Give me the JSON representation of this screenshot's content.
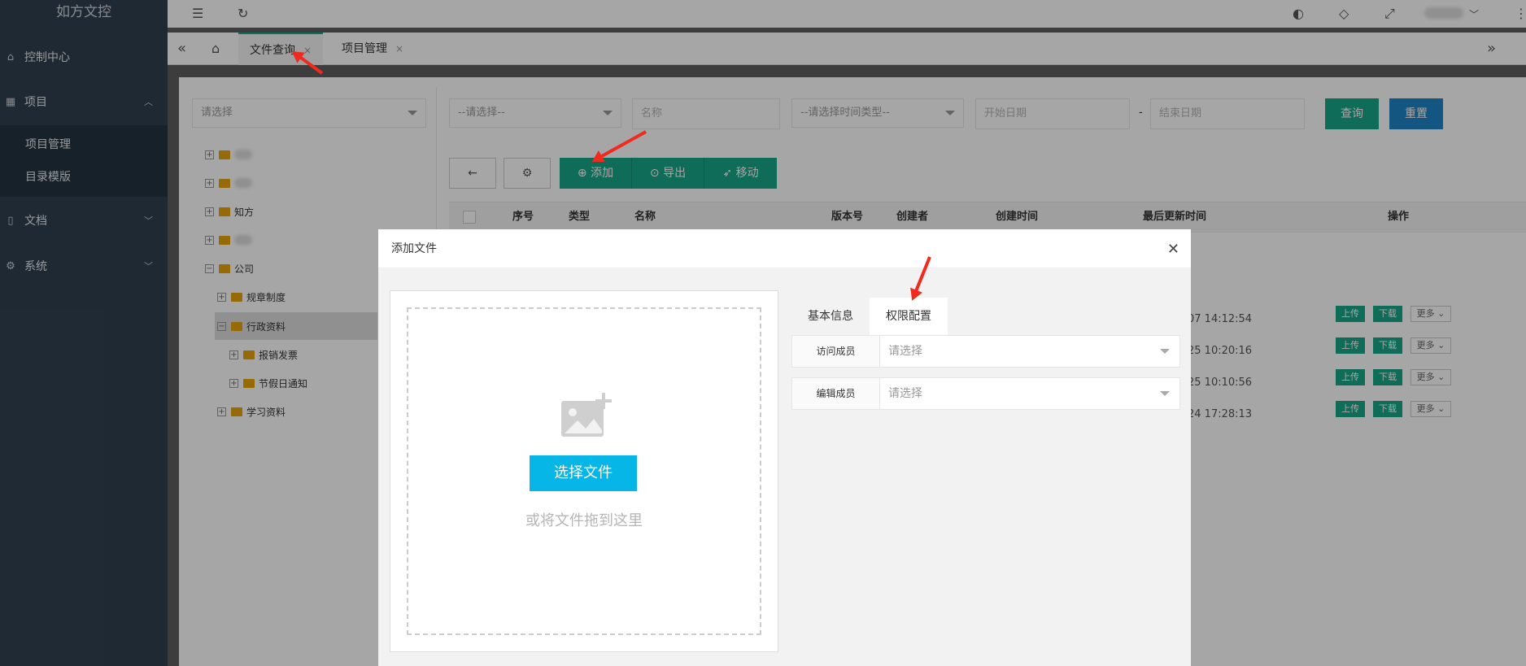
{
  "sidebar": {
    "brand": "如方文控",
    "items": [
      {
        "label": "控制中心",
        "icon": "home-icon"
      },
      {
        "label": "项目",
        "icon": "grid-icon"
      },
      {
        "label": "文档",
        "icon": "document-icon"
      },
      {
        "label": "系统",
        "icon": "gear-icon"
      }
    ],
    "sub_items": [
      "项目管理",
      "目录模版"
    ]
  },
  "tabs": [
    {
      "label": "文件查询"
    },
    {
      "label": "项目管理"
    }
  ],
  "tree": {
    "select_placeholder": "请选择",
    "nodes": [
      {
        "label": "知方"
      },
      {
        "label": "公司"
      },
      {
        "label": "规章制度"
      },
      {
        "label": "行政资料"
      },
      {
        "label": "报销发票"
      },
      {
        "label": "节假日通知"
      },
      {
        "label": "学习资料"
      }
    ]
  },
  "filters": {
    "category_placeholder": "--请选择--",
    "name_placeholder": "名称",
    "time_type_placeholder": "--请选择时间类型--",
    "start_date": "开始日期",
    "date_sep": "-",
    "end_date": "结束日期",
    "query_label": "查询",
    "reset_label": "重置"
  },
  "toolbar": {
    "add_label": "添加",
    "export_label": "导出",
    "move_label": "移动"
  },
  "table": {
    "headers": [
      "序号",
      "类型",
      "名称",
      "版本号",
      "创建者",
      "创建时间",
      "最后更新时间",
      "操作"
    ],
    "rows": [
      {
        "time": "07 14:12:54"
      },
      {
        "time": "25 10:20:16"
      },
      {
        "time": "25 10:10:56"
      },
      {
        "time": "24 17:28:13"
      }
    ],
    "upload_label": "上传",
    "download_label": "下载",
    "more_label": "更多"
  },
  "modal": {
    "title": "添加文件",
    "choose_file_label": "选择文件",
    "drop_hint": "或将文件拖到这里",
    "tabs": [
      "基本信息",
      "权限配置"
    ],
    "fields": [
      {
        "label": "访问成员",
        "placeholder": "请选择"
      },
      {
        "label": "编辑成员",
        "placeholder": "请选择"
      }
    ]
  },
  "colors": {
    "sidebar": "#2f4050",
    "primary_green": "#18a689",
    "blue": "#1c84c6",
    "file_button": "#06b6e6",
    "annotation_red": "#f02a1e"
  }
}
